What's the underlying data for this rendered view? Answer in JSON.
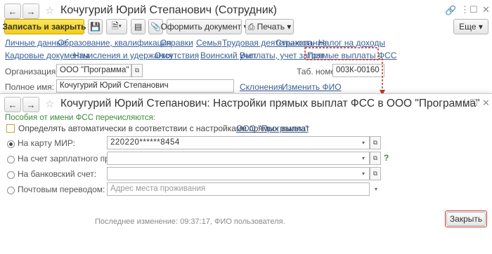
{
  "main": {
    "title": "Кочугурий Юрий Степанович (Сотрудник)",
    "toolbar": {
      "save_close": "Записать и закрыть",
      "create_doc": "Оформить документ",
      "print": "Печать",
      "more": "Еще"
    },
    "links_row1": [
      "Личные данные",
      "Образование, квалификация",
      "Справки",
      "Семья",
      "Трудовая деятельность",
      "Страхование",
      "Налог на доходы"
    ],
    "links_row2": [
      "Кадровые документы",
      "Начисления и удержания",
      "Отсутствия",
      "Воинский учет",
      "Выплаты, учет затрат",
      "Прямые выплаты ФСС"
    ],
    "org_label": "Организация:",
    "org_value": "ООО \"Программа\"",
    "tab_label": "Таб. номер:",
    "tab_value": "003К-00160",
    "fullname_label": "Полное имя:",
    "fullname_value": "Кочугурий Юрий Степанович",
    "declension_link": "Склонения",
    "change_name_link": "Изменить ФИО"
  },
  "dialog": {
    "title": "Кочугурий Юрий Степанович: Настройки прямых выплат ФСС в ООО \"Программа\"",
    "section_header": "Пособия от имени ФСС перечисляются:",
    "auto_checkbox_label": "Определять автоматически в соответствии с настройками прямых выплат",
    "org_link": "ООО \"Программа\"",
    "options": [
      {
        "label": "На карту МИР:",
        "value": "220220******8454",
        "placeholder": "",
        "checked": true
      },
      {
        "label": "На счет зарплатного проекта:",
        "value": "",
        "placeholder": "",
        "checked": false
      },
      {
        "label": "На банковский счет:",
        "value": "",
        "placeholder": "",
        "checked": false
      },
      {
        "label": "Почтовым переводом:",
        "value": "",
        "placeholder": "Адрес места проживания",
        "checked": false
      }
    ],
    "help_mark": "?",
    "last_change": "Последнее изменение: 09:37:17, ФИО пользователя.",
    "close_button": "Закрыть"
  },
  "colors": {
    "accent_yellow": "#f2cd17",
    "link_blue": "#3a5e96",
    "section_green": "#3c8a3c",
    "highlight_red": "#c0392b"
  }
}
